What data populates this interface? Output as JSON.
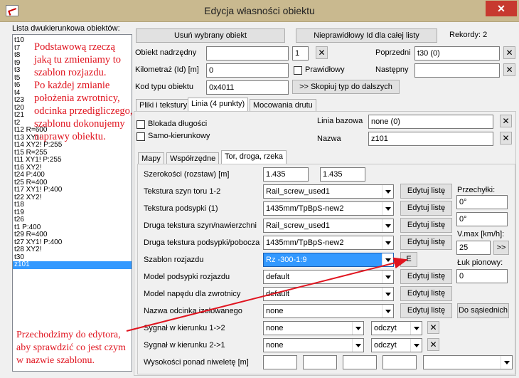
{
  "window": {
    "title": "Edycja własności obiektu",
    "close_glyph": "✕"
  },
  "left": {
    "list_label": "Lista dwukierunkowa obiektów:",
    "items": [
      "t10",
      "t7",
      "t8",
      "t9",
      "t3",
      "t5",
      "t6",
      "t4",
      "t23",
      "t20",
      "t21",
      "t2",
      "t12 R=600",
      "t13 XY1!",
      "t14 XY2! P:255",
      "t15 R=255",
      "t11 XY1! P:255",
      "t16 XY2!",
      "t24 P:400",
      "t25 R=400",
      "t17 XY1! P:400",
      "t22 XY2!",
      "t18",
      "t19",
      "t26",
      "t1 P:400",
      "t29 R=400",
      "t27 XY1! P:400",
      "t28 XY2!",
      "t30",
      "z101"
    ],
    "selected_index": 30
  },
  "top": {
    "delete_btn": "Usuń wybrany obiekt",
    "bad_id_btn": "Nieprawidłowy Id dla całej listy",
    "records": "Rekordy: 2",
    "parent_label": "Obiekt nadrzędny",
    "parent_value": "",
    "parent_num": "1",
    "prev_label": "Poprzedni",
    "prev_value": "t30 (0)",
    "km_label": "Kilometraż (Id) [m]",
    "km_value": "0",
    "right_chk": "Prawidłowy",
    "next_label": "Następny",
    "next_value": "",
    "type_label": "Kod typu obiektu",
    "type_value": "0x4011",
    "copy_btn": ">> Skopiuj typ do dalszych",
    "x": "✕"
  },
  "tabs1": [
    "Pliki i tekstury",
    "Linia (4 punkty)",
    "Mocowania drutu"
  ],
  "linia": {
    "block_len": "Blokada długości",
    "self_dir": "Samo-kierunkowy",
    "base_label": "Linia bazowa",
    "base_value": "none (0)",
    "name_label": "Nazwa",
    "name_value": "z101"
  },
  "tabs2": [
    "Mapy",
    "Współrzędne",
    "Tor, droga, rzeka"
  ],
  "tor": {
    "width_label": "Szerokości (rozstaw) [m]",
    "width1": "1.435",
    "width2": "1.435",
    "rows": [
      {
        "label": "Tekstura szyn toru 1-2",
        "value": "Rail_screw_used1"
      },
      {
        "label": "Tekstura podsypki (1)",
        "value": "1435mm/TpBpS-new2"
      },
      {
        "label": "Druga tekstura szyn/nawierzchni",
        "value": "Rail_screw_used1"
      },
      {
        "label": "Druga tekstura podsypki/pobocza",
        "value": "1435mm/TpBpS-new2"
      }
    ],
    "edit_btn": "Edytuj listę",
    "switch_label": "Szablon rozjazdu",
    "switch_value": "Rz -300-1:9",
    "e_btn": "E",
    "model_sub_label": "Model podsypki rozjazdu",
    "model_sub_value": "default",
    "model_drive_label": "Model napędu dla zwrotnicy",
    "model_drive_value": "default",
    "iso_label": "Nazwa odcinka izolowanego",
    "iso_value": "none",
    "neighbors_btn": "Do sąsiednich",
    "sig12_label": "Sygnał w kierunku 1->2",
    "sig12_value": "none",
    "sig12_read": "odczyt",
    "sig21_label": "Sygnał w kierunku 2->1",
    "sig21_value": "none",
    "sig21_read": "odczyt",
    "heights_label": "Wysokości ponad niweletę [m]",
    "tilt_label": "Przechyłki:",
    "tilt1": "0°",
    "tilt2": "0°",
    "vmax_label": "V.max [km/h]:",
    "vmax_value": "25",
    "vmax_btn": ">>",
    "arc_label": "Łuk pionowy:",
    "arc_value": "0"
  },
  "annotations": {
    "top_lines": [
      "Podstawową rzeczą",
      "jaką tu zmieniamy to",
      "szablon rozjazdu.",
      "Po każdej zmianie",
      "położenia zwrotnicy,",
      "odcinka przedigliczego,",
      "szablonu dokonujemy",
      "naprawy obiektu."
    ],
    "bottom_lines": [
      "Przechodzimy do edytora,",
      "aby sprawdzić co jest czym",
      "w nazwie szablonu."
    ],
    "color": "#e0141f"
  }
}
